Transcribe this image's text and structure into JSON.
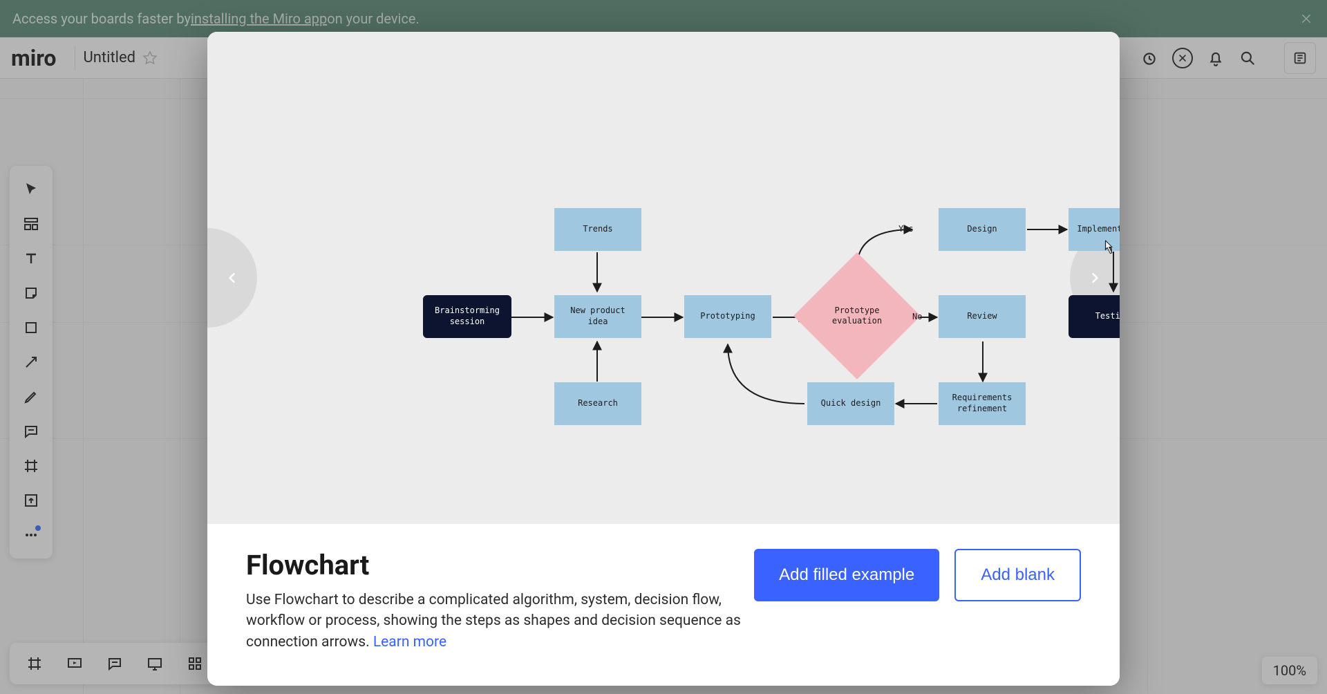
{
  "banner": {
    "pre": "Access your boards faster by ",
    "link": "installing the Miro app",
    "post": " on your device."
  },
  "header": {
    "logo": "miro",
    "board_title": "Untitled"
  },
  "zoom": "100%",
  "modal": {
    "title": "Flowchart",
    "description": "Use Flowchart to describe a complicated algorithm, system, decision flow, workflow or process, showing the steps as shapes and decision sequence as connection arrows. ",
    "learn_more": "Learn more",
    "actions": {
      "primary": "Add filled example",
      "secondary": "Add blank"
    },
    "nodes": {
      "brainstorming": "Brainstorming session",
      "trends": "Trends",
      "new_product": "New product idea",
      "research": "Research",
      "prototyping": "Prototyping",
      "prototype_eval": "Prototype evaluation",
      "quick_design": "Quick design",
      "design": "Design",
      "review": "Review",
      "requirements": "Requirements refinement",
      "implementation": "Implementation",
      "testing": "Testing"
    },
    "edges": {
      "yes": "Yes",
      "no": "No"
    }
  }
}
